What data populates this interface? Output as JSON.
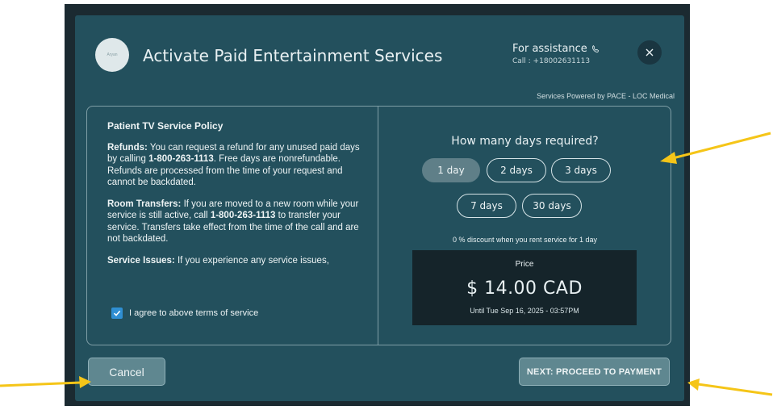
{
  "header": {
    "title": "Activate Paid Entertainment Services",
    "logo_text": "Aryan",
    "assistance_label": "For assistance",
    "assistance_call": "Call : +18002631113",
    "close_symbol": "×",
    "powered_by": "Services Powered by PACE - LOC Medical"
  },
  "policy": {
    "title": "Patient TV Service Policy",
    "refunds_label": "Refunds:",
    "refunds_text_1": " You can request a refund for any unused paid days by calling ",
    "refunds_phone": "1-800-263-1113",
    "refunds_text_2": ". Free days are nonrefundable. Refunds are processed from the time of your request and cannot be backdated.",
    "transfers_label": "Room Transfers:",
    "transfers_text_1": " If you are moved to a new room while your service is still active, call ",
    "transfers_phone": "1-800-263-1113",
    "transfers_text_2": " to transfer your service. Transfers take effect from the time of the call and are not backdated.",
    "issues_label": "Service Issues:",
    "issues_text": " If you experience any service issues,"
  },
  "agree": {
    "label": "I agree to above terms of service",
    "checked": true
  },
  "days": {
    "question": "How many days required?",
    "options": [
      "1 day",
      "2 days",
      "3 days",
      "7 days",
      "30 days"
    ],
    "selected": "1 day",
    "discount_text": "0 % discount when you rent service for 1 day"
  },
  "price": {
    "label": "Price",
    "value": "$ 14.00 CAD",
    "until": "Until Tue Sep 16, 2025 - 03:57PM"
  },
  "footer": {
    "cancel_label": "Cancel",
    "next_label": "NEXT: PROCEED TO PAYMENT"
  },
  "colors": {
    "modal_bg": "#23505d",
    "annotation_arrow": "#f5c518",
    "checkbox": "#2f8fd3"
  }
}
